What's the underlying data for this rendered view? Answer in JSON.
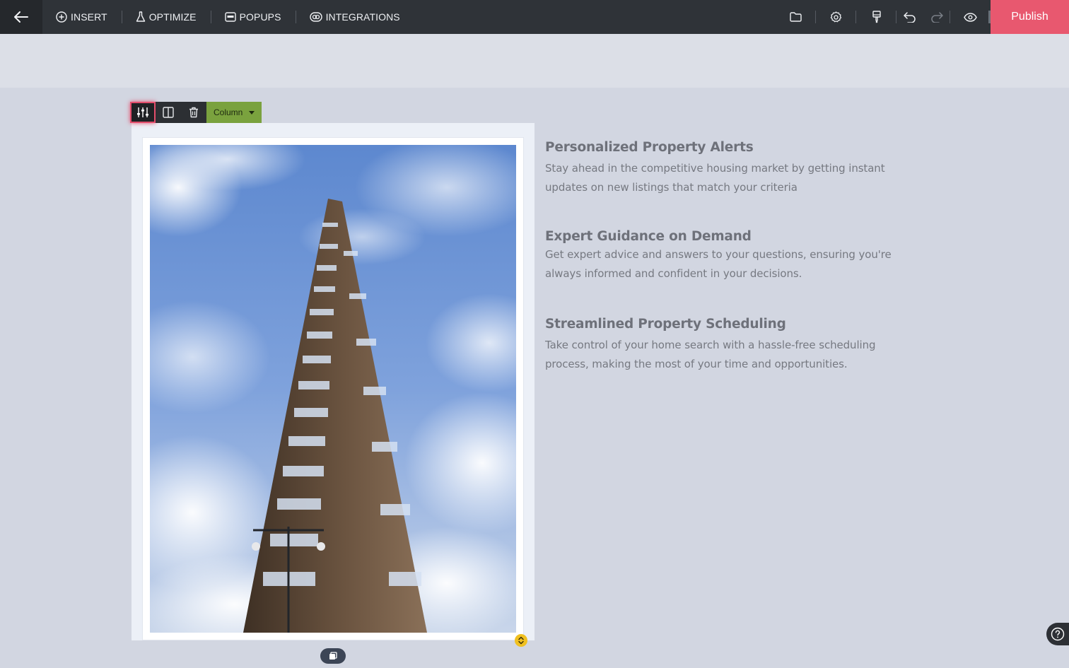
{
  "toolbar": {
    "nav": [
      {
        "label": "INSERT",
        "icon": "plus-circle-icon"
      },
      {
        "label": "OPTIMIZE",
        "icon": "flask-icon"
      },
      {
        "label": "POPUPS",
        "icon": "popup-icon"
      },
      {
        "label": "INTEGRATIONS",
        "icon": "integrations-icon"
      }
    ],
    "publish_label": "Publish"
  },
  "column_toolbar": {
    "select_label": "Column"
  },
  "features": [
    {
      "title": "Personalized Property Alerts",
      "body": "Stay ahead in the competitive housing market by getting instant updates on new listings that match your criteria"
    },
    {
      "title": "Expert Guidance on Demand",
      "body": "Get expert advice and answers to your questions, ensuring you're always informed and confident in your decisions."
    },
    {
      "title": "Streamlined Property Scheduling",
      "body": "Take control of your home search with a hassle-free scheduling process, making the most of your time and opportunities."
    }
  ],
  "colors": {
    "toolbar_bg": "#2f3338",
    "publish_bg": "#e8586f",
    "column_select_bg": "#7aa23e",
    "canvas_bg": "#d2d6e1"
  }
}
